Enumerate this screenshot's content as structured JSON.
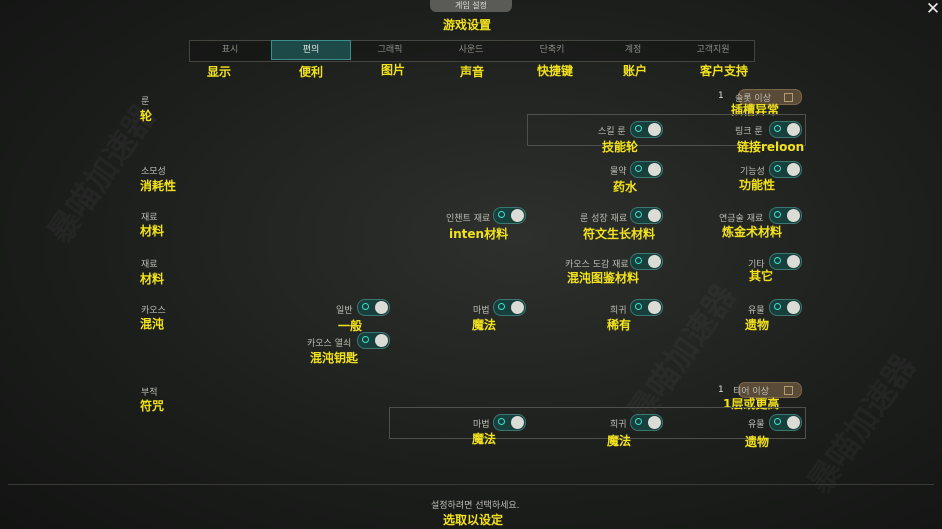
{
  "header": {
    "badge": "게임 설정",
    "title_zh": "游戏设置"
  },
  "tabs": [
    {
      "ko": "표시",
      "zh": "显示"
    },
    {
      "ko": "편의",
      "zh": "便利"
    },
    {
      "ko": "그래픽",
      "zh": "图片"
    },
    {
      "ko": "사운드",
      "zh": "声音"
    },
    {
      "ko": "단축키",
      "zh": "快捷键"
    },
    {
      "ko": "계정",
      "zh": "账户"
    },
    {
      "ko": "고객지원",
      "zh": "客户支持"
    }
  ],
  "rows": {
    "rune": {
      "ko": "룬",
      "zh": "轮",
      "slot": {
        "value": "1",
        "ko": "슬롯 이상",
        "zh": "插槽异常"
      },
      "skill_rune": {
        "ko": "스킬 룬",
        "zh": "技能轮",
        "on": true
      },
      "link_rune": {
        "ko": "링크 룬",
        "zh": "链接reloon",
        "on": true
      }
    },
    "consumable": {
      "ko": "소모성",
      "zh": "消耗性",
      "potion": {
        "ko": "물약",
        "zh": "药水",
        "on": true
      },
      "functional": {
        "ko": "기능성",
        "zh": "功能性",
        "on": true
      }
    },
    "material1": {
      "ko": "재료",
      "zh": "材料",
      "enchant": {
        "ko": "인챈트 재료",
        "zh": "inten材料",
        "on": true
      },
      "rune_growth": {
        "ko": "룬 성장 재료",
        "zh": "符文生长材料",
        "on": true
      },
      "alchemy": {
        "ko": "연금술 재료",
        "zh": "炼金术材料",
        "on": true
      }
    },
    "material2": {
      "ko": "재료",
      "zh": "材料",
      "chaos_codex": {
        "ko": "카오스 도감 재료",
        "zh": "混沌图鉴材料",
        "on": true
      },
      "other": {
        "ko": "기타",
        "zh": "其它",
        "on": true
      }
    },
    "chaos": {
      "ko": "카오스",
      "zh": "混沌",
      "normal": {
        "ko": "일반",
        "zh": "一般",
        "on": true
      },
      "magic": {
        "ko": "마법",
        "zh": "魔法",
        "on": true
      },
      "rare": {
        "ko": "희귀",
        "zh": "稀有",
        "on": true
      },
      "relic": {
        "ko": "유물",
        "zh": "遗物",
        "on": true
      },
      "chaos_key": {
        "ko": "카오스 열쇠",
        "zh": "混沌钥匙",
        "on": true
      }
    },
    "charm": {
      "ko": "부적",
      "zh": "符咒",
      "tier": {
        "value": "1",
        "ko": "티어 이상",
        "zh": "1层或更高"
      },
      "magic": {
        "ko": "마법",
        "zh": "魔法",
        "on": true
      },
      "rare": {
        "ko": "희귀",
        "zh": "魔法",
        "on": true
      },
      "relic": {
        "ko": "유물",
        "zh": "遗物",
        "on": true
      }
    }
  },
  "footer": {
    "ko": "설정하려면 선택하세요.",
    "zh": "选取以设定"
  },
  "colors": {
    "accent": "#f2e21c",
    "toggle_on": "#17403d",
    "tab_active": "#1d4a48"
  },
  "icons": {
    "close": "close-icon",
    "dropdown": "pin-icon"
  }
}
